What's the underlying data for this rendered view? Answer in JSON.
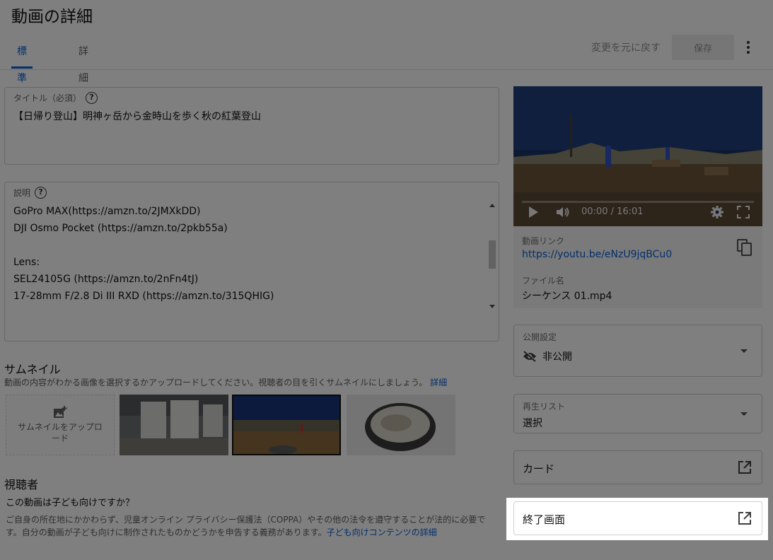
{
  "header": {
    "title": "動画の詳細",
    "tabs": [
      {
        "label": "標準",
        "active": true
      },
      {
        "label": "詳細",
        "active": false
      }
    ],
    "undo_label": "変更を元に戻す",
    "save_label": "保存"
  },
  "title_field": {
    "label": "タイトル（必須）",
    "value": "【日帰り登山】明神ヶ岳から金時山を歩く秋の紅葉登山"
  },
  "description_field": {
    "label": "説明",
    "lines": [
      "GoPro MAX(https://amzn.to/2JMXkDD)",
      "DJI Osmo Pocket (https://amzn.to/2pkb55a)",
      "",
      "Lens:",
      "SEL24105G (https://amzn.to/2nFn4tJ)",
      "17-28mm F/2.8 Di III RXD (https://amzn.to/315QHIG)"
    ]
  },
  "thumbnail": {
    "title": "サムネイル",
    "subtitle": "動画の内容がわかる画像を選択するかアップロードしてください。視聴者の目を引くサムネイルにしましょう。",
    "subtitle_link": "詳細",
    "upload_label": "サムネイルをアップロード"
  },
  "audience": {
    "title": "視聴者",
    "question": "この動画は子ども向けですか？",
    "text": "ご自身の所在地にかかわらず、児童オンライン プライバシー保護法（COPPA）やその他の法令を遵守することが法的に必要です。自分の動画が子ども向けに制作されたものかどうかを申告する義務があります。",
    "text_link": "子ども向けコンテンツの詳細"
  },
  "video": {
    "time": "00:00 / 16:01",
    "link_label": "動画リンク",
    "link_url": "https://youtu.be/eNzU9jqBCu0",
    "file_label": "ファイル名",
    "file_name": "シーケンス 01.mp4"
  },
  "visibility": {
    "label": "公開設定",
    "value": "非公開"
  },
  "playlist": {
    "label": "再生リスト",
    "value": "選択"
  },
  "cards": {
    "label": "カード"
  },
  "end_screen": {
    "label": "終了画面"
  },
  "colors": {
    "accent": "#065fd4",
    "overlay": "rgba(0,0,0,0.5)"
  }
}
